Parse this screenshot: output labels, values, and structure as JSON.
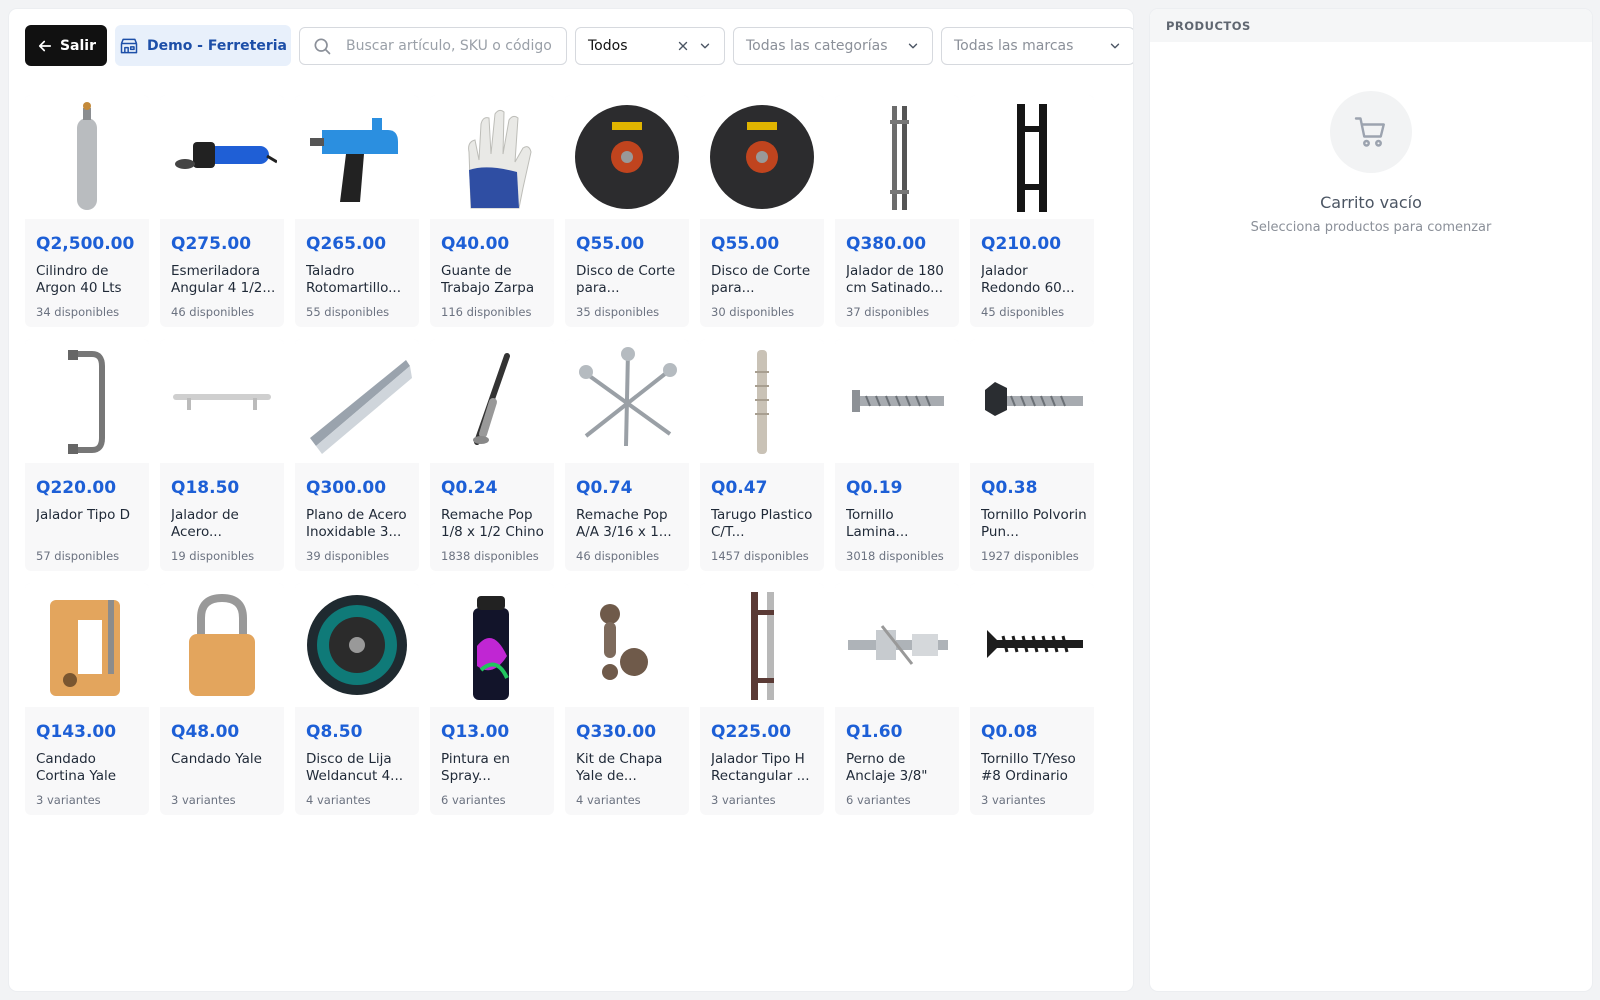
{
  "toolbar": {
    "exit_label": "Salir",
    "store_label": "Demo - Ferreteria",
    "search_placeholder": "Buscar artículo, SKU o código",
    "filter_value": "Todos",
    "category_placeholder": "Todas las categorías",
    "brand_placeholder": "Todas las marcas"
  },
  "products": [
    {
      "price": "Q2,500.00",
      "name": "Cilindro de Argon 40 Lts",
      "stock": "34 disponibles",
      "icon": "gas-cylinder-icon"
    },
    {
      "price": "Q275.00",
      "name": "Esmeriladora Angular 4 1/2...",
      "stock": "46 disponibles",
      "icon": "angle-grinder-icon"
    },
    {
      "price": "Q265.00",
      "name": "Taladro Rotomartillo...",
      "stock": "55 disponibles",
      "icon": "drill-icon"
    },
    {
      "price": "Q40.00",
      "name": "Guante de Trabajo Zarpa",
      "stock": "116 disponibles",
      "icon": "work-glove-icon"
    },
    {
      "price": "Q55.00",
      "name": "Disco de Corte para...",
      "stock": "35 disponibles",
      "icon": "cutting-disc-icon"
    },
    {
      "price": "Q55.00",
      "name": "Disco de Corte para...",
      "stock": "30 disponibles",
      "icon": "cutting-disc-icon"
    },
    {
      "price": "Q380.00",
      "name": "Jalador de 180 cm Satinado...",
      "stock": "37 disponibles",
      "icon": "door-pull-icon"
    },
    {
      "price": "Q210.00",
      "name": "Jalador Redondo 60...",
      "stock": "45 disponibles",
      "icon": "h-pull-handle-icon"
    },
    {
      "price": "Q220.00",
      "name": "Jalador Tipo D",
      "stock": "57 disponibles",
      "icon": "d-handle-icon"
    },
    {
      "price": "Q18.50",
      "name": "Jalador de Acero...",
      "stock": "19 disponibles",
      "icon": "bar-handle-icon"
    },
    {
      "price": "Q300.00",
      "name": "Plano de Acero Inoxidable 3...",
      "stock": "39 disponibles",
      "icon": "steel-profile-icon"
    },
    {
      "price": "Q0.24",
      "name": "Remache Pop 1/8 x 1/2 Chino",
      "stock": "1838 disponibles",
      "icon": "rivet-icon"
    },
    {
      "price": "Q0.74",
      "name": "Remache Pop A/A 3/16 x 1...",
      "stock": "46 disponibles",
      "icon": "rivets-icon"
    },
    {
      "price": "Q0.47",
      "name": "Tarugo Plastico C/T...",
      "stock": "1457 disponibles",
      "icon": "wall-plug-icon"
    },
    {
      "price": "Q0.19",
      "name": "Tornillo Lamina...",
      "stock": "3018 disponibles",
      "icon": "sheet-screw-icon"
    },
    {
      "price": "Q0.38",
      "name": "Tornillo Polvorin Pun...",
      "stock": "1927 disponibles",
      "icon": "hex-screw-icon"
    },
    {
      "price": "Q143.00",
      "name": "Candado Cortina Yale",
      "stock": "3 variantes",
      "icon": "shutter-padlock-icon"
    },
    {
      "price": "Q48.00",
      "name": "Candado Yale",
      "stock": "3 variantes",
      "icon": "padlock-icon"
    },
    {
      "price": "Q8.50",
      "name": "Disco de Lija Weldancut 4...",
      "stock": "4 variantes",
      "icon": "flap-disc-icon"
    },
    {
      "price": "Q13.00",
      "name": "Pintura en Spray...",
      "stock": "6 variantes",
      "icon": "spray-paint-icon"
    },
    {
      "price": "Q330.00",
      "name": "Kit de Chapa Yale de...",
      "stock": "4 variantes",
      "icon": "lock-kit-icon"
    },
    {
      "price": "Q225.00",
      "name": "Jalador Tipo H Rectangular ...",
      "stock": "3 variantes",
      "icon": "h-handle-icon"
    },
    {
      "price": "Q1.60",
      "name": "Perno de Anclaje 3/8\"",
      "stock": "6 variantes",
      "icon": "anchor-bolt-icon"
    },
    {
      "price": "Q0.08",
      "name": "Tornillo T/Yeso #8 Ordinario",
      "stock": "3 variantes",
      "icon": "drywall-screw-icon"
    }
  ],
  "cart": {
    "header": "PRODUCTOS",
    "empty_title": "Carrito vacío",
    "empty_subtitle": "Selecciona productos para comenzar"
  },
  "colors": {
    "price": "#1d5fd6",
    "exit_button": "#111111",
    "store_badge_bg": "#e8f0fb"
  }
}
